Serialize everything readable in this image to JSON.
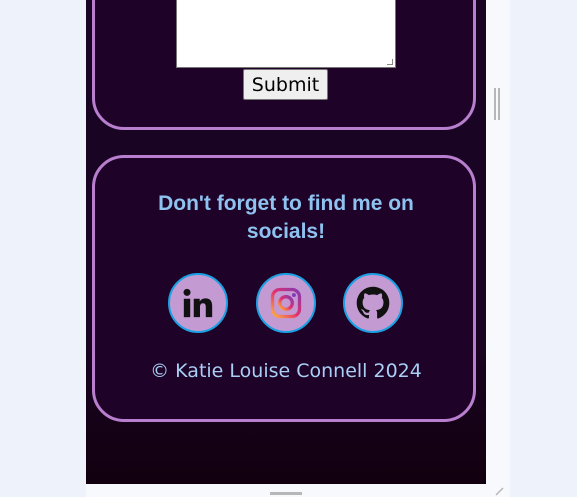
{
  "form": {
    "submit_label": "Submit"
  },
  "socials": {
    "heading": "Don't forget to find me on socials!",
    "links": [
      {
        "icon": "linkedin-icon"
      },
      {
        "icon": "instagram-icon"
      },
      {
        "icon": "github-icon"
      }
    ]
  },
  "footer": {
    "copyright": "© Katie Louise Connell 2024"
  },
  "colors": {
    "page_bg": "#1a0423",
    "card_border": "#b97fcf",
    "heading": "#8ec2ef",
    "icon_bg": "#c49ad2",
    "icon_ring": "#1aa0e3"
  }
}
